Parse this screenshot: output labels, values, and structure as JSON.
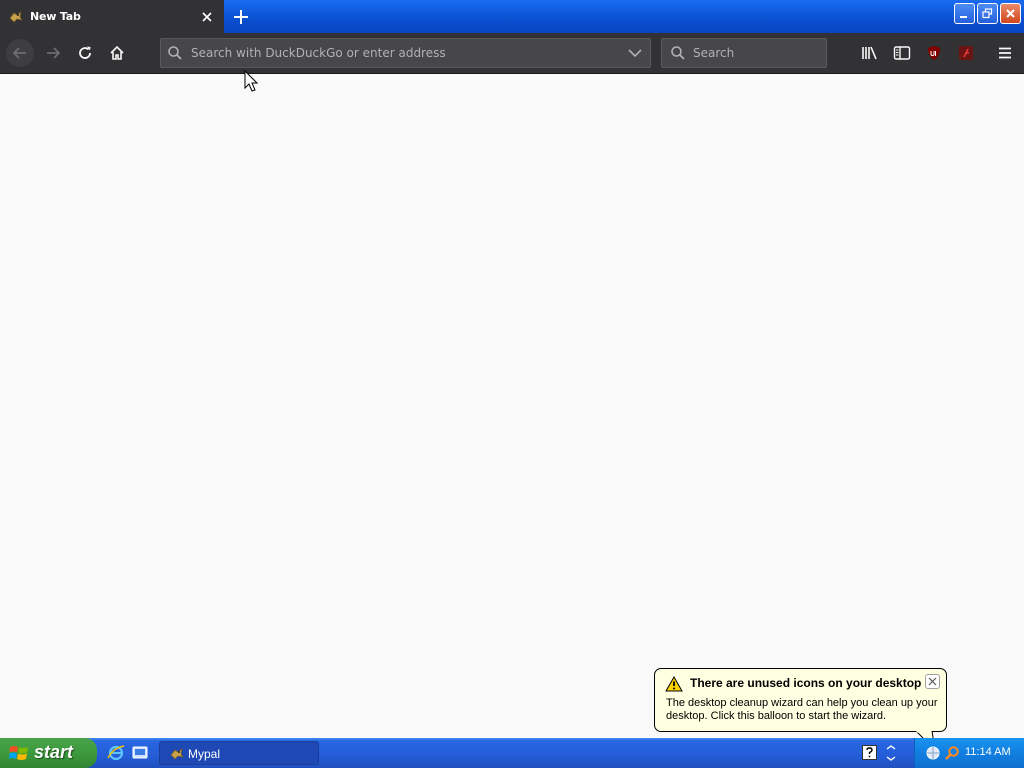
{
  "window": {
    "tab_title": "New Tab",
    "app_icon": "mypal-icon"
  },
  "toolbar": {
    "url_placeholder": "Search with DuckDuckGo or enter address",
    "search_placeholder": "Search"
  },
  "balloon": {
    "title": "There are unused icons on your desktop",
    "body": "The desktop cleanup wizard can help you clean up your desktop. Click this balloon to start the wizard."
  },
  "taskbar": {
    "start_label": "start",
    "task_label": "Mypal",
    "clock": "11:14 AM"
  },
  "colors": {
    "toolbar_bg": "#323234",
    "content_bg": "#f9f9fa",
    "balloon_bg": "#ffffe1",
    "taskbar_blue": "#245dd8",
    "start_green": "#3d9a3d"
  }
}
